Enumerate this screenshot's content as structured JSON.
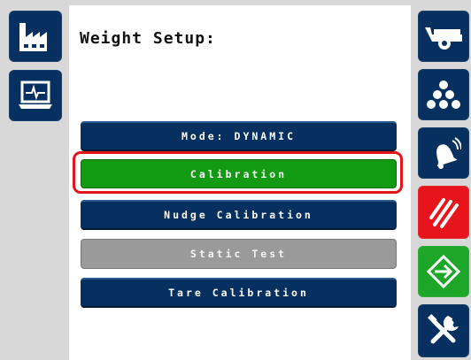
{
  "header": {
    "title": "Weight Setup:"
  },
  "buttons": {
    "mode": "Mode: DYNAMIC",
    "calibration": "Calibration",
    "nudge_calibration": "Nudge Calibration",
    "static_test": "Static Test",
    "tare_calibration": "Tare Calibration"
  },
  "selected": "Calibration",
  "left_nav": [
    {
      "icon": "factory-icon"
    },
    {
      "icon": "monitor-icon"
    }
  ],
  "right_nav": [
    {
      "icon": "cart-icon"
    },
    {
      "icon": "dots-pyramid-icon"
    },
    {
      "icon": "alarm-bell-icon"
    },
    {
      "icon": "hatch-stripes-icon",
      "color": "#e8141c"
    },
    {
      "icon": "enter-arrow-icon",
      "color": "#1ea628"
    },
    {
      "icon": "tools-icon"
    }
  ],
  "colors": {
    "navy": "#06305f",
    "green_selected": "#139a13",
    "gray_disabled": "#9a9a9a",
    "highlight_red": "#e2141c"
  }
}
